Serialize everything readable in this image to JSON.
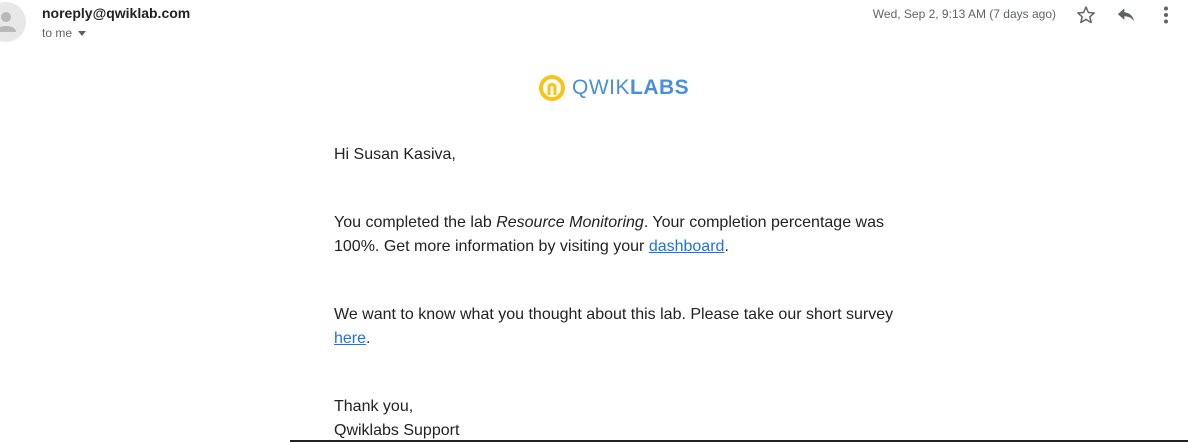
{
  "header": {
    "sender": "noreply@qwiklab.com",
    "recipient": "to me",
    "date": "Wed, Sep 2, 9:13 AM (7 days ago)",
    "icons": {
      "avatar": "person-icon",
      "caret": "caret-down-icon",
      "star": "star-icon",
      "reply": "reply-icon",
      "more": "more-vertical-icon"
    }
  },
  "logo": {
    "text_light": "QWIK",
    "text_bold": "LABS",
    "brand_color": "#4a8fd9",
    "mark_color": "#f5c518"
  },
  "message": {
    "greeting": "Hi Susan Kasiva,",
    "para1_prefix": "You completed the lab ",
    "lab_name": "Resource Monitoring",
    "para1_middle": ". Your completion percentage was 100%. Get more information by visiting your ",
    "dashboard_link": "dashboard",
    "para1_suffix": ".",
    "para2_prefix": "We want to know what you thought about this lab. Please take our short survey ",
    "survey_link": "here",
    "para2_suffix": ".",
    "signoff": "Thank you,",
    "signature": "Qwiklabs Support"
  },
  "colors": {
    "link": "#1a73e8",
    "text": "#222222",
    "muted": "#5f6368"
  }
}
